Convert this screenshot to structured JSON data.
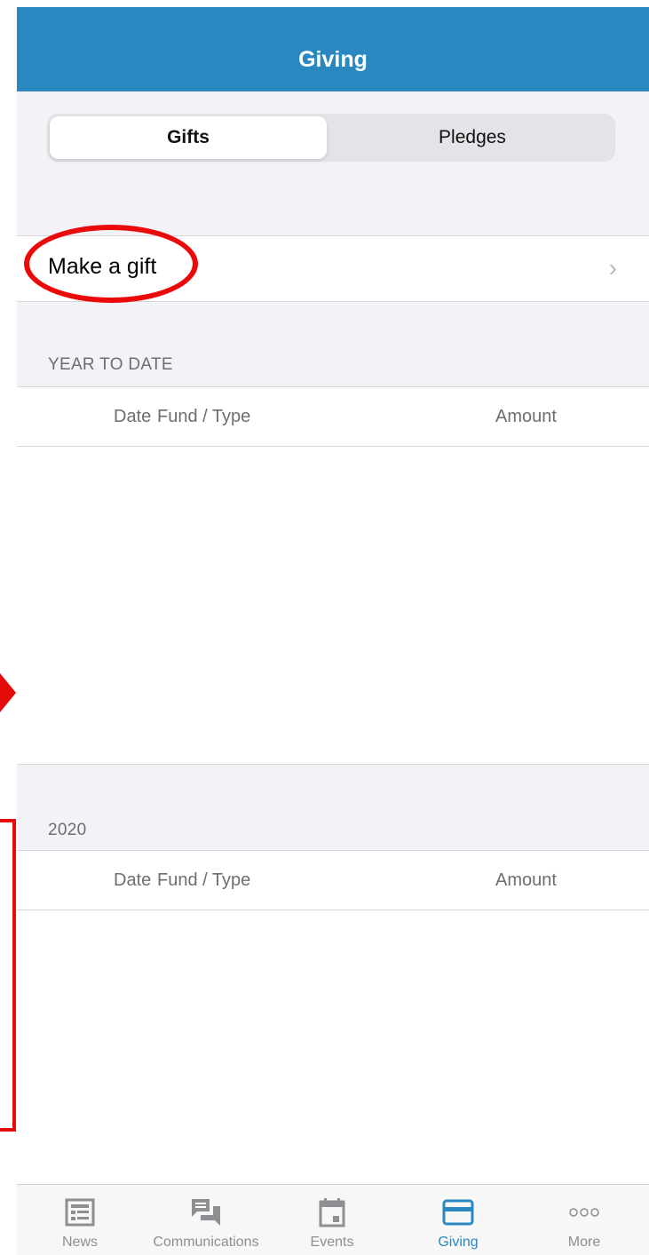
{
  "navbar": {
    "title": "Giving"
  },
  "segmented": {
    "tabs": [
      {
        "label": "Gifts",
        "active": true
      },
      {
        "label": "Pledges",
        "active": false
      }
    ]
  },
  "make_gift": {
    "label": "Make a gift",
    "chevron": "›"
  },
  "sections": [
    {
      "header": "YEAR TO DATE",
      "columns": {
        "date": "Date",
        "fund": "Fund / Type",
        "amount": "Amount"
      },
      "rows": []
    },
    {
      "header": "2020",
      "columns": {
        "date": "Date",
        "fund": "Fund / Type",
        "amount": "Amount"
      },
      "rows": []
    }
  ],
  "tabbar": {
    "items": [
      {
        "label": "News",
        "icon": "news-icon",
        "active": false
      },
      {
        "label": "Communications",
        "icon": "chat-icon",
        "active": false
      },
      {
        "label": "Events",
        "icon": "calendar-icon",
        "active": false
      },
      {
        "label": "Giving",
        "icon": "card-icon",
        "active": true
      },
      {
        "label": "More",
        "icon": "more-icon",
        "active": false
      }
    ]
  },
  "colors": {
    "accent": "#2a88c0",
    "annotation_red": "#e50b0b",
    "background": "#f2f2f7"
  }
}
